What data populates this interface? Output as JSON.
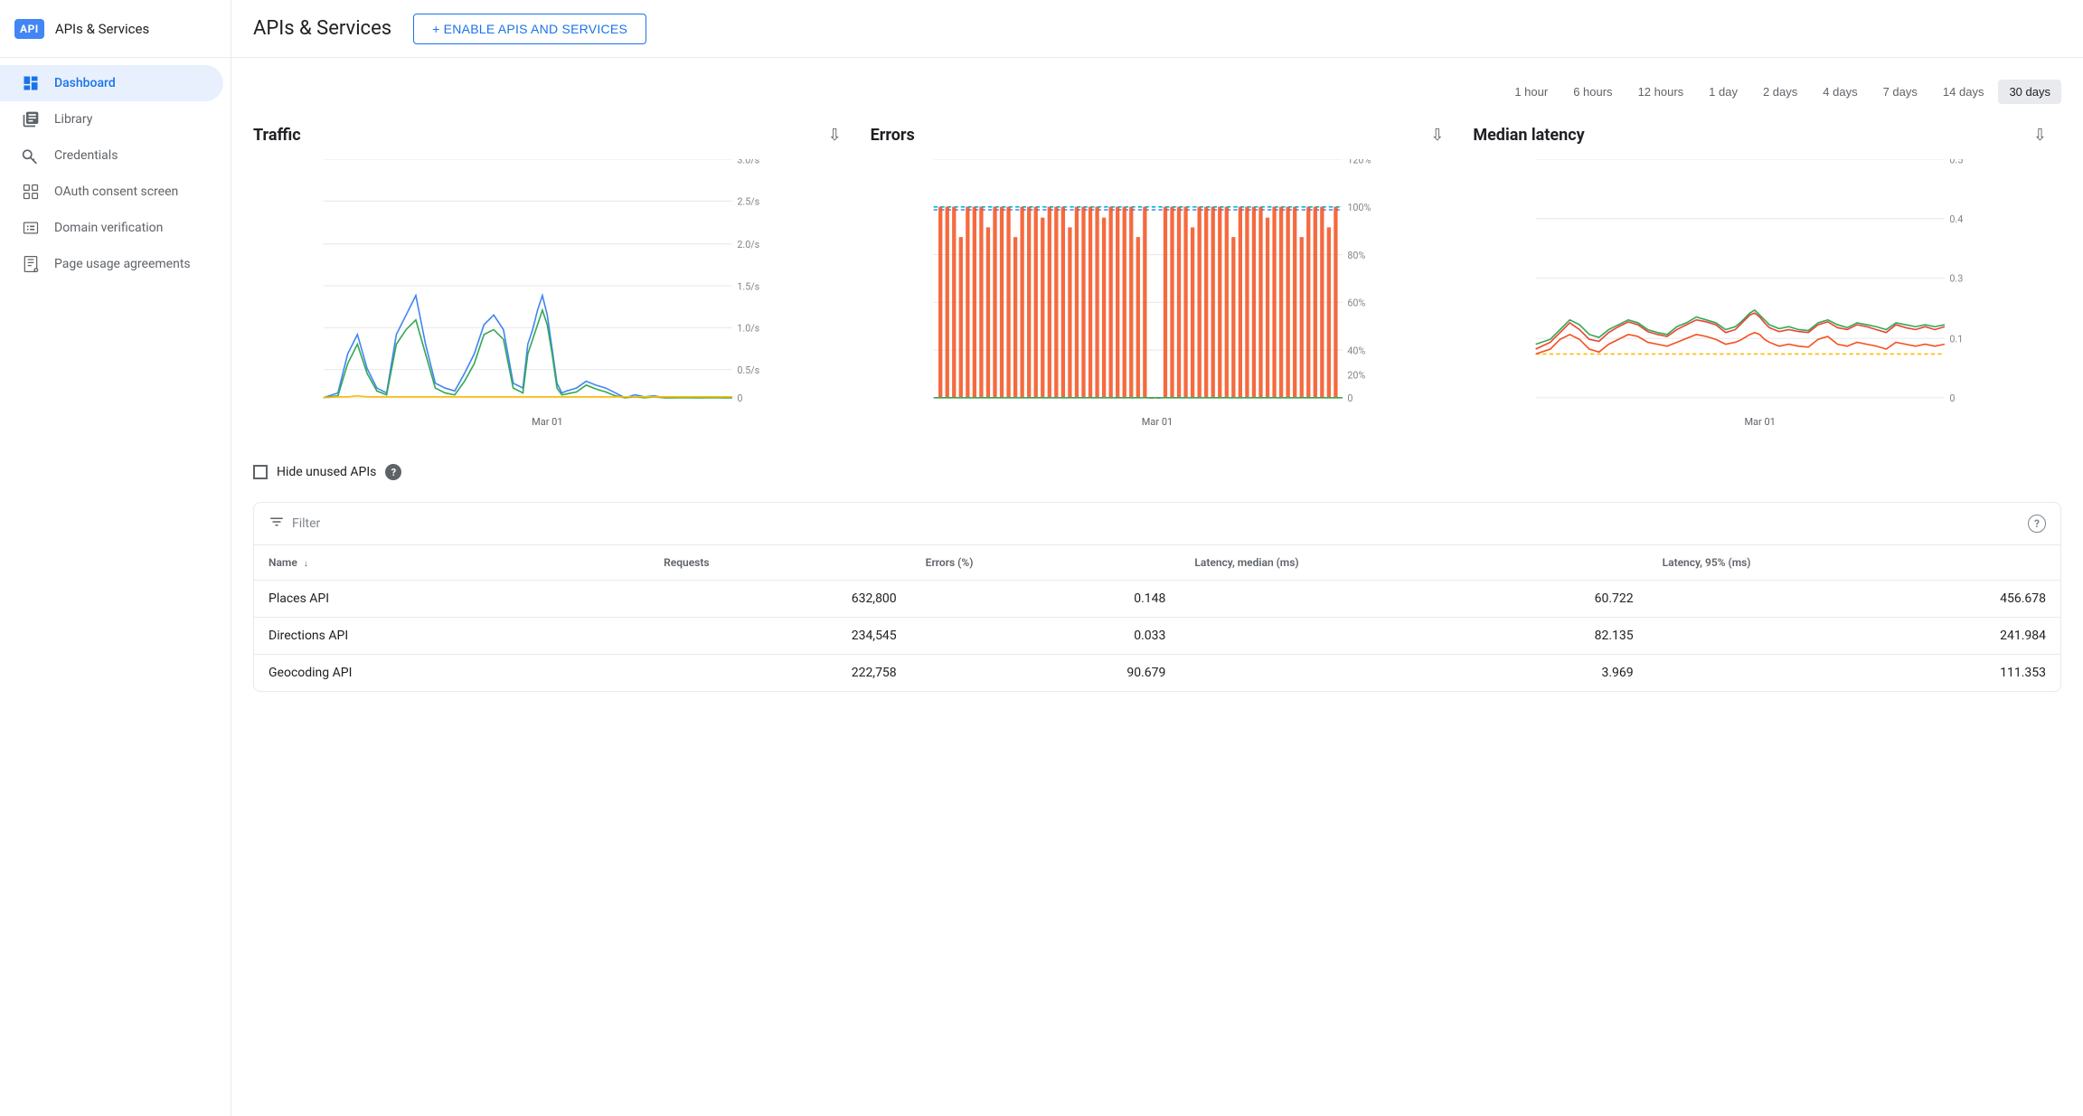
{
  "sidebar": {
    "logo": "API",
    "title": "APIs & Services",
    "nav_items": [
      {
        "id": "dashboard",
        "label": "Dashboard",
        "icon": "dashboard",
        "active": true
      },
      {
        "id": "library",
        "label": "Library",
        "icon": "library",
        "active": false
      },
      {
        "id": "credentials",
        "label": "Credentials",
        "icon": "credentials",
        "active": false
      },
      {
        "id": "oauth",
        "label": "OAuth consent screen",
        "icon": "oauth",
        "active": false
      },
      {
        "id": "domain",
        "label": "Domain verification",
        "icon": "domain",
        "active": false
      },
      {
        "id": "pageusage",
        "label": "Page usage agreements",
        "icon": "pageusage",
        "active": false
      }
    ]
  },
  "header": {
    "title": "APIs & Services",
    "enable_button": "+ ENABLE APIS AND SERVICES"
  },
  "time_range": {
    "options": [
      "1 hour",
      "6 hours",
      "12 hours",
      "1 day",
      "2 days",
      "4 days",
      "7 days",
      "14 days",
      "30 days"
    ],
    "active": "30 days"
  },
  "charts": [
    {
      "id": "traffic",
      "title": "Traffic",
      "date_label": "Mar 01"
    },
    {
      "id": "errors",
      "title": "Errors",
      "date_label": "Mar 01"
    },
    {
      "id": "median_latency",
      "title": "Median latency",
      "date_label": "Mar 01"
    }
  ],
  "hide_apis": {
    "label": "Hide unused APIs",
    "checked": false
  },
  "table": {
    "filter_placeholder": "Filter",
    "columns": [
      {
        "id": "name",
        "label": "Name",
        "sortable": true,
        "sort_dir": "desc"
      },
      {
        "id": "requests",
        "label": "Requests",
        "sortable": false
      },
      {
        "id": "errors_pct",
        "label": "Errors (%)",
        "sortable": false
      },
      {
        "id": "latency_median",
        "label": "Latency, median (ms)",
        "sortable": false
      },
      {
        "id": "latency_95",
        "label": "Latency, 95% (ms)",
        "sortable": false
      }
    ],
    "rows": [
      {
        "name": "Places API",
        "requests": "632,800",
        "errors_pct": "0.148",
        "latency_median": "60.722",
        "latency_95": "456.678"
      },
      {
        "name": "Directions API",
        "requests": "234,545",
        "errors_pct": "0.033",
        "latency_median": "82.135",
        "latency_95": "241.984"
      },
      {
        "name": "Geocoding API",
        "requests": "222,758",
        "errors_pct": "90.679",
        "latency_median": "3.969",
        "latency_95": "111.353"
      }
    ]
  }
}
